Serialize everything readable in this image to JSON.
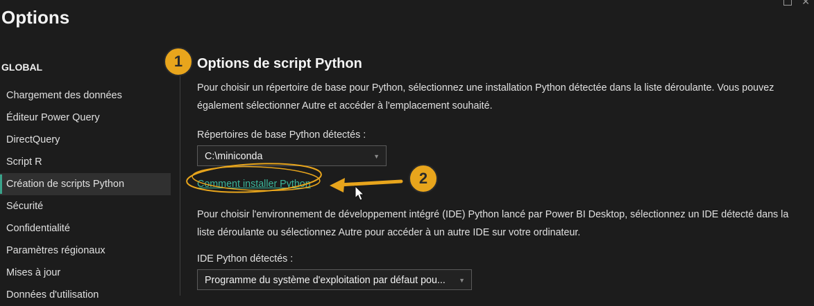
{
  "window": {
    "title": "Options"
  },
  "sidebar": {
    "heading": "GLOBAL",
    "items": [
      {
        "label": "Chargement des données"
      },
      {
        "label": "Éditeur Power Query"
      },
      {
        "label": "DirectQuery"
      },
      {
        "label": "Script R"
      },
      {
        "label": "Création de scripts Python",
        "active": true
      },
      {
        "label": "Sécurité"
      },
      {
        "label": "Confidentialité"
      },
      {
        "label": "Paramètres régionaux"
      },
      {
        "label": "Mises à jour"
      },
      {
        "label": "Données d'utilisation"
      }
    ]
  },
  "main": {
    "title": "Options de script Python",
    "intro": "Pour choisir un répertoire de base pour Python, sélectionnez une installation Python détectée dans la liste déroulante. Vous pouvez également sélectionner Autre et accéder à l'emplacement souhaité.",
    "home_dirs_label": "Répertoires de base Python détectés :",
    "home_dir_value": "C:\\miniconda",
    "install_link": "Comment installer Python",
    "ide_intro": "Pour choisir l'environnement de développement intégré (IDE) Python lancé par Power BI Desktop, sélectionnez un IDE détecté dans la liste déroulante ou sélectionnez Autre pour accéder à un autre IDE sur votre ordinateur.",
    "ide_label": "IDE Python détectés :",
    "ide_value": "Programme du système d'exploitation par défaut pou..."
  },
  "annotations": {
    "badge1": "1",
    "badge2": "2",
    "color": "#e8a51c"
  },
  "colors": {
    "background": "#1c1c1c",
    "accent_link": "#3bb59a",
    "active_indicator": "#3aa28a"
  }
}
